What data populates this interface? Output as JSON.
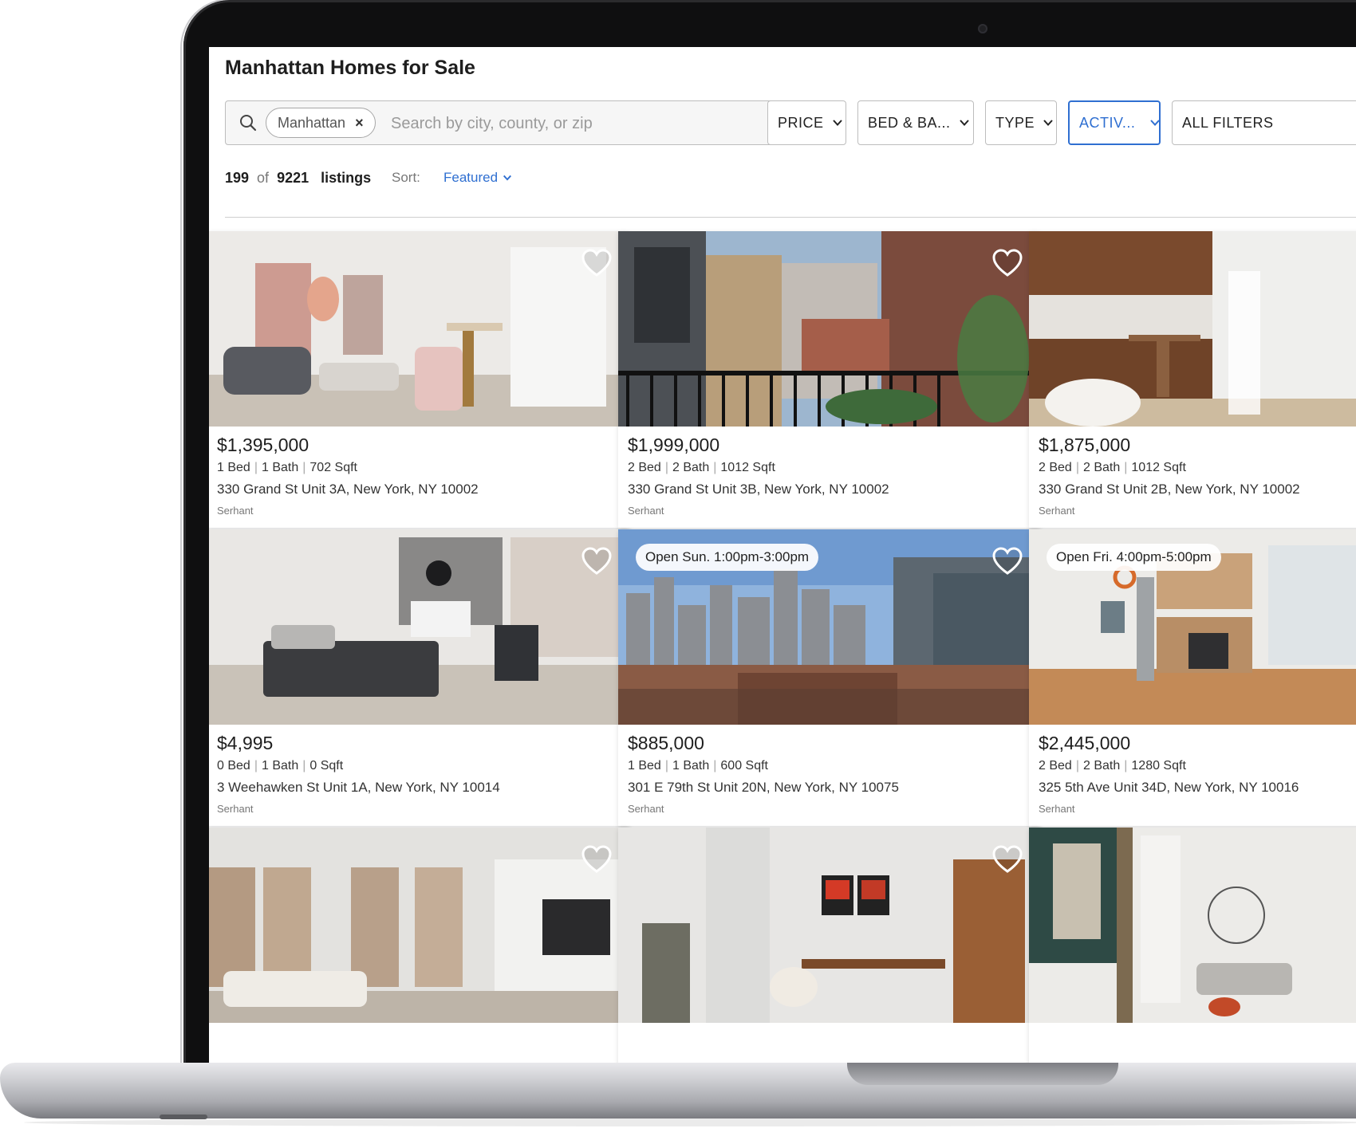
{
  "page": {
    "title": "Manhattan Homes for Sale"
  },
  "search": {
    "chip_label": "Manhattan",
    "chip_remove": "×",
    "placeholder": "Search by city, county, or zip",
    "value": ""
  },
  "filters": [
    {
      "label": "PRICE",
      "active": false
    },
    {
      "label": "BED & BA...",
      "active": false
    },
    {
      "label": "TYPE",
      "active": false
    },
    {
      "label": "ACTIV...",
      "active": true
    },
    {
      "label": "ALL FILTERS",
      "active": false
    }
  ],
  "results": {
    "shown": "199",
    "of": "of",
    "total": "9221",
    "unit": "listings",
    "sort_label": "Sort:",
    "sort_value": "Featured"
  },
  "colors": {
    "accent": "#2f6fd1",
    "text": "#1e1e1e"
  },
  "listings": [
    {
      "price": "$1,395,000",
      "beds": "1 Bed",
      "baths": "1 Bath",
      "sqft": "702 Sqft",
      "address": "330 Grand St Unit 3A, New York, NY 10002",
      "broker": "Serhant",
      "open_house": ""
    },
    {
      "price": "$1,999,000",
      "beds": "2 Bed",
      "baths": "2 Bath",
      "sqft": "1012 Sqft",
      "address": "330 Grand St Unit 3B, New York, NY 10002",
      "broker": "Serhant",
      "open_house": ""
    },
    {
      "price": "$1,875,000",
      "beds": "2 Bed",
      "baths": "2 Bath",
      "sqft": "1012 Sqft",
      "address": "330 Grand St Unit 2B, New York, NY 10002",
      "broker": "Serhant",
      "open_house": ""
    },
    {
      "price": "$4,995",
      "beds": "0 Bed",
      "baths": "1 Bath",
      "sqft": "0 Sqft",
      "address": "3 Weehawken St Unit 1A, New York, NY 10014",
      "broker": "Serhant",
      "open_house": ""
    },
    {
      "price": "$885,000",
      "beds": "1 Bed",
      "baths": "1 Bath",
      "sqft": "600 Sqft",
      "address": "301 E 79th St Unit 20N, New York, NY 10075",
      "broker": "Serhant",
      "open_house": "Open Sun. 1:00pm-3:00pm"
    },
    {
      "price": "$2,445,000",
      "beds": "2 Bed",
      "baths": "2 Bath",
      "sqft": "1280 Sqft",
      "address": "325 5th Ave Unit 34D, New York, NY 10016",
      "broker": "Serhant",
      "open_house": "Open Fri. 4:00pm-5:00pm"
    },
    {
      "price": "",
      "beds": "",
      "baths": "",
      "sqft": "",
      "address": "",
      "broker": "",
      "open_house": ""
    },
    {
      "price": "",
      "beds": "",
      "baths": "",
      "sqft": "",
      "address": "",
      "broker": "",
      "open_house": ""
    },
    {
      "price": "",
      "beds": "",
      "baths": "",
      "sqft": "",
      "address": "",
      "broker": "",
      "open_house": ""
    }
  ]
}
